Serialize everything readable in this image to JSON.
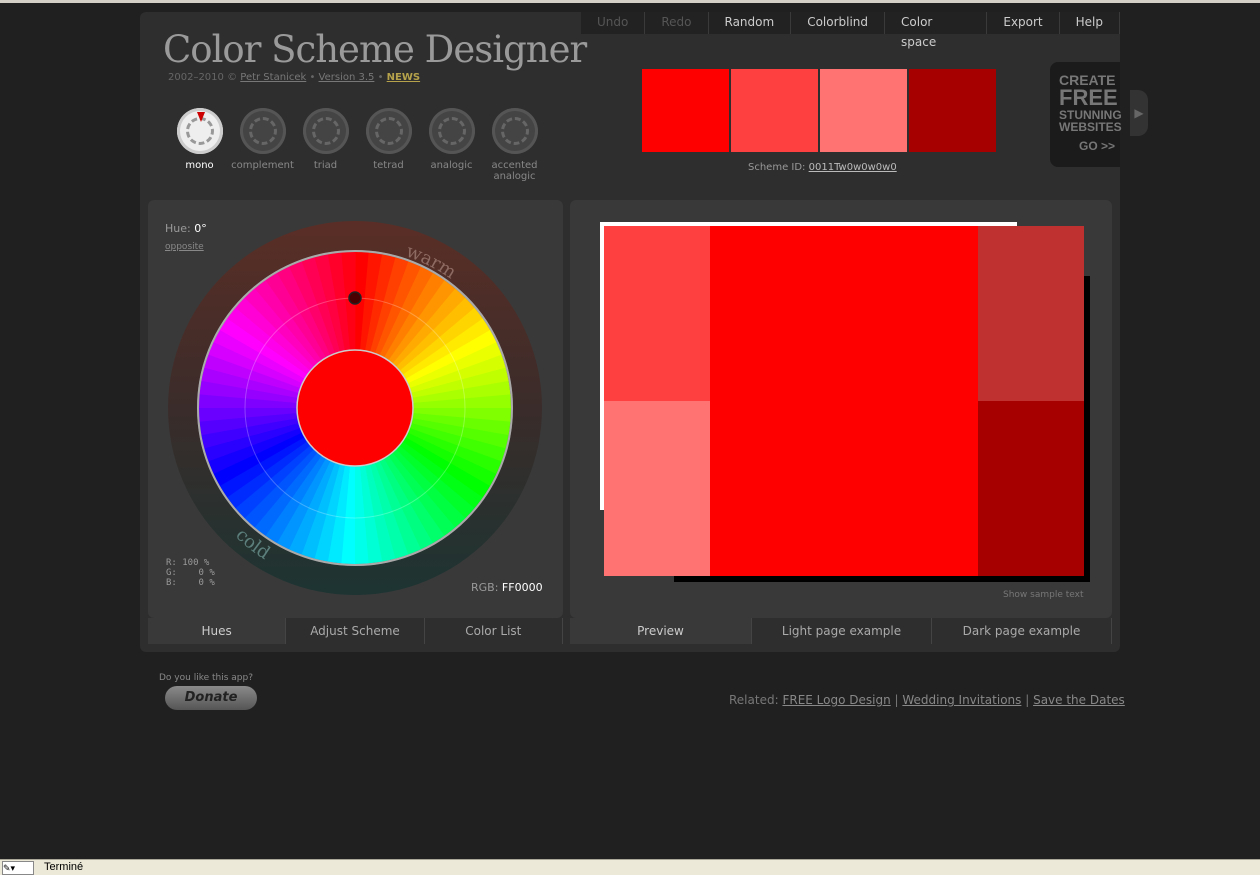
{
  "app": {
    "title": "Color Scheme Designer",
    "credits": {
      "years": "2002–2010 ©",
      "author": "Petr Stanicek",
      "version": "Version 3.5",
      "news": "NEWS"
    }
  },
  "menu": [
    {
      "label": "Undo",
      "enabled": false
    },
    {
      "label": "Redo",
      "enabled": false
    },
    {
      "label": "Random",
      "enabled": true
    },
    {
      "label": "Colorblind",
      "enabled": true
    },
    {
      "label": "Color space",
      "enabled": true
    },
    {
      "label": "Export",
      "enabled": true
    },
    {
      "label": "Help",
      "enabled": true
    }
  ],
  "schemes": [
    {
      "label": "mono",
      "selected": true
    },
    {
      "label": "complement",
      "selected": false
    },
    {
      "label": "triad",
      "selected": false
    },
    {
      "label": "tetrad",
      "selected": false
    },
    {
      "label": "analogic",
      "selected": false
    },
    {
      "label": "accented analogic",
      "selected": false
    }
  ],
  "swatches": [
    "#FF0000",
    "#FF4040",
    "#FF7373",
    "#A60000"
  ],
  "scheme_id": {
    "label": "Scheme ID:",
    "value": "0011Tw0w0w0w0"
  },
  "ad": {
    "create": "CREATE",
    "free": "FREE",
    "stunning": "STUNNING",
    "websites": "WEBSITES",
    "go": "GO >>"
  },
  "wheel": {
    "hue_label": "Hue:",
    "hue_value": "0°",
    "opposite": "opposite",
    "warm": "warm",
    "cold": "cold",
    "r": "R: 100 %",
    "g": "G:    0 %",
    "b": "B:    0 %",
    "rgb_label": "RGB:",
    "rgb_value": "FF0000",
    "hue_fraction": 0.0
  },
  "left_tabs": [
    {
      "label": "Hues",
      "active": true
    },
    {
      "label": "Adjust Scheme",
      "active": false
    },
    {
      "label": "Color List",
      "active": false
    }
  ],
  "preview": {
    "colors": {
      "main": "#FF0000",
      "light1": "#FF4040",
      "light2": "#FF7373",
      "dark1": "#BF3030",
      "dark2": "#A60000"
    },
    "show_sample": "Show sample text"
  },
  "right_tabs": [
    {
      "label": "Preview",
      "active": true
    },
    {
      "label": "Light page example",
      "active": false
    },
    {
      "label": "Dark page example",
      "active": false
    }
  ],
  "footer": {
    "donate_question": "Do you like this app?",
    "donate": "Donate",
    "related_label": "Related:",
    "links": [
      "FREE Logo Design",
      "Wedding Invitations",
      "Save the Dates"
    ]
  },
  "statusbar": {
    "text": "Terminé"
  }
}
